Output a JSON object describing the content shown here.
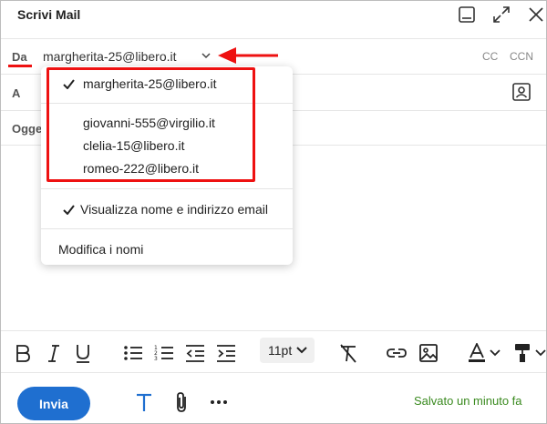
{
  "window": {
    "title": "Scrivi Mail",
    "icons": [
      "minimize-icon",
      "expand-icon",
      "close-icon"
    ]
  },
  "from": {
    "label": "Da",
    "value": "margherita-25@libero.it",
    "cc_label": "CC",
    "bcc_label": "CCN"
  },
  "to": {
    "label": "A"
  },
  "subject": {
    "label": "Ogge"
  },
  "dropdown": {
    "accounts": [
      {
        "email": "margherita-25@libero.it",
        "selected": true
      },
      {
        "email": "giovanni-555@virgilio.it",
        "selected": false
      },
      {
        "email": "clelia-15@libero.it",
        "selected": false
      },
      {
        "email": "romeo-222@libero.it",
        "selected": false
      }
    ],
    "show_name_email": {
      "label": "Visualizza nome e indirizzo email",
      "checked": true
    },
    "edit_names": "Modifica i nomi"
  },
  "toolbar": {
    "font_size": "11pt"
  },
  "footer": {
    "send_label": "Invia",
    "saved_status": "Salvato un minuto fa"
  },
  "colors": {
    "accent": "#1f6fd0",
    "annotation": "#e11111",
    "saved_text": "#3a8a1f"
  }
}
